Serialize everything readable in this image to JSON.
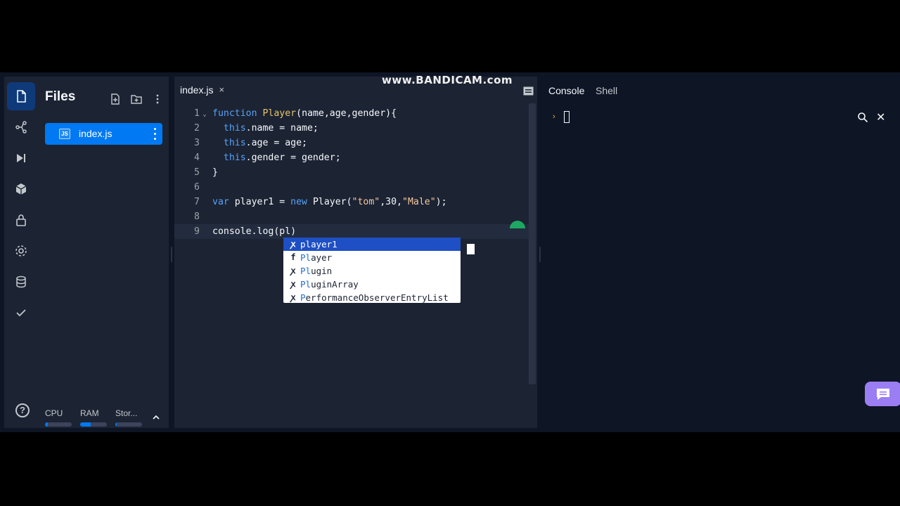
{
  "watermark": "www.BANDICAM.com",
  "sidebar": {
    "title": "Files",
    "file": {
      "name": "index.js",
      "badge": "JS"
    },
    "help": "?",
    "resources": [
      {
        "label": "CPU",
        "level": 0.1
      },
      {
        "label": "RAM",
        "level": 0.4
      },
      {
        "label": "Stor...",
        "level": 0.05
      }
    ]
  },
  "editor": {
    "tab": {
      "label": "index.js",
      "close": "×"
    },
    "lines": [
      {
        "num": "1",
        "fold": "⌄"
      },
      {
        "num": "2"
      },
      {
        "num": "3"
      },
      {
        "num": "4"
      },
      {
        "num": "5"
      },
      {
        "num": "6"
      },
      {
        "num": "7"
      },
      {
        "num": "8"
      },
      {
        "num": "9",
        "active": true
      }
    ],
    "code": {
      "l1_kw": "function",
      "l1_fn": "Player",
      "l1_rest": "(name,age,gender){",
      "l2_this": "this",
      "l2_rest": ".name = name;",
      "l3_this": "this",
      "l3_rest": ".age = age;",
      "l4_this": "this",
      "l4_rest": ".gender = gender;",
      "l5": "}",
      "l7_kw": "var",
      "l7_a": " player1 = ",
      "l7_new": "new",
      "l7_b": " Player(",
      "l7_s1": "\"tom\"",
      "l7_c": ",30,",
      "l7_s2": "\"Male\"",
      "l7_d": ");",
      "l9": "console.log(pl)"
    },
    "suggestions": [
      {
        "icon": "ꭗ",
        "match": "pl",
        "rest": "ayer1",
        "selected": true
      },
      {
        "icon": "f",
        "match": "Pl",
        "rest": "ayer"
      },
      {
        "icon": "ꭗ",
        "match": "Pl",
        "rest": "ugin"
      },
      {
        "icon": "ꭗ",
        "match": "Pl",
        "rest": "uginArray"
      },
      {
        "icon": "ꭗ",
        "match": "P",
        "rest": "erformanceObserverEntryList"
      }
    ]
  },
  "console": {
    "tabs": [
      "Console",
      "Shell"
    ],
    "prompt": "›",
    "close": "✕"
  }
}
